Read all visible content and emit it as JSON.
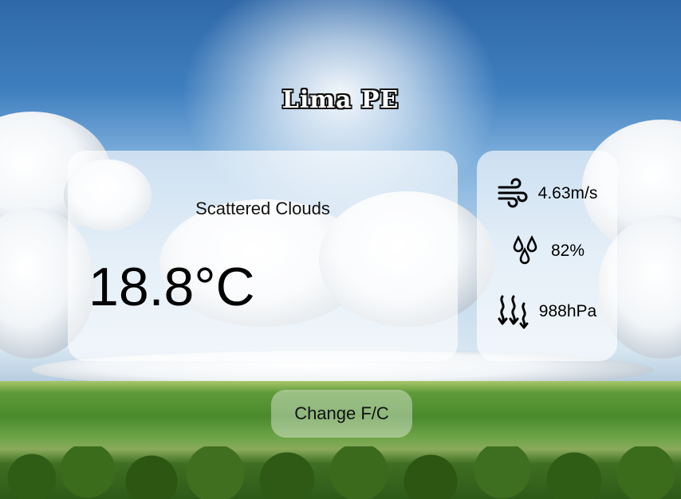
{
  "location": {
    "city": "Lima PE"
  },
  "current": {
    "description": "Scattered Clouds",
    "temperature": "18.8°C"
  },
  "stats": {
    "wind": {
      "icon": "wind-icon",
      "value": "4.63m/s"
    },
    "humidity": {
      "icon": "humidity-drops-icon",
      "value": "82%"
    },
    "pressure": {
      "icon": "pressure-arrows-icon",
      "value": "988hPa"
    }
  },
  "controls": {
    "toggle_unit_label": "Change F/C"
  }
}
